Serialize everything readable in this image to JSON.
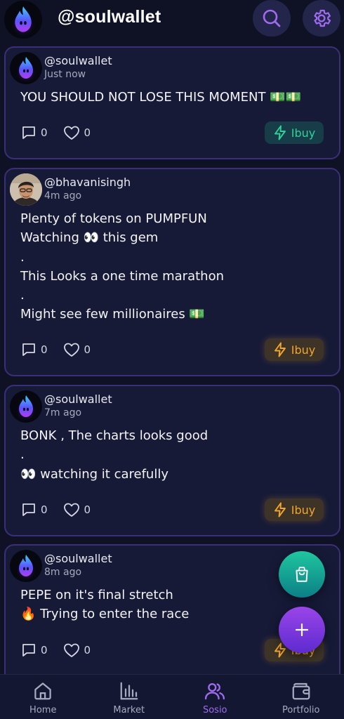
{
  "header": {
    "title": "@soulwallet"
  },
  "colors": {
    "background": "#0f1124",
    "card": "#161a37",
    "card_border": "#3a2f78",
    "accent": "#a16bf0",
    "green": "#2fd19a",
    "orange": "#f4a42a"
  },
  "posts": [
    {
      "handle": "@soulwallet",
      "time": "Just now",
      "body": "YOU SHOULD NOT LOSE THIS MOMENT 💵💵",
      "comments": "0",
      "likes": "0",
      "buy_label": "Ibuy",
      "buy_style": "green",
      "avatar": "soulwallet-flame-icon"
    },
    {
      "handle": "@bhavanisingh",
      "time": "4m ago",
      "body": "Plenty of tokens on PUMPFUN\nWatching 👀 this gem\n.\nThis Looks a one time marathon\n.\nMight see few millionaires 💵",
      "comments": "0",
      "likes": "0",
      "buy_label": "Ibuy",
      "buy_style": "orange",
      "avatar": "user-photo"
    },
    {
      "handle": "@soulwallet",
      "time": "7m ago",
      "body": "BONK , The charts looks good\n.\n👀 watching it carefully",
      "comments": "0",
      "likes": "0",
      "buy_label": "Ibuy",
      "buy_style": "orange",
      "avatar": "soulwallet-flame-icon"
    },
    {
      "handle": "@soulwallet",
      "time": "8m ago",
      "body": "PEPE on it's final stretch\n🔥 Trying to enter the race",
      "comments": "0",
      "likes": "0",
      "buy_label": "Ibuy",
      "buy_style": "orange",
      "avatar": "soulwallet-flame-icon"
    }
  ],
  "fabs": {
    "bag_icon": "shopping-bag-icon",
    "add_icon": "plus-icon"
  },
  "nav": {
    "items": [
      {
        "label": "Home",
        "icon": "home-icon",
        "active": false
      },
      {
        "label": "Market",
        "icon": "bar-chart-icon",
        "active": false
      },
      {
        "label": "Sosio",
        "icon": "users-icon",
        "active": true
      },
      {
        "label": "Portfolio",
        "icon": "wallet-icon",
        "active": false
      }
    ]
  }
}
